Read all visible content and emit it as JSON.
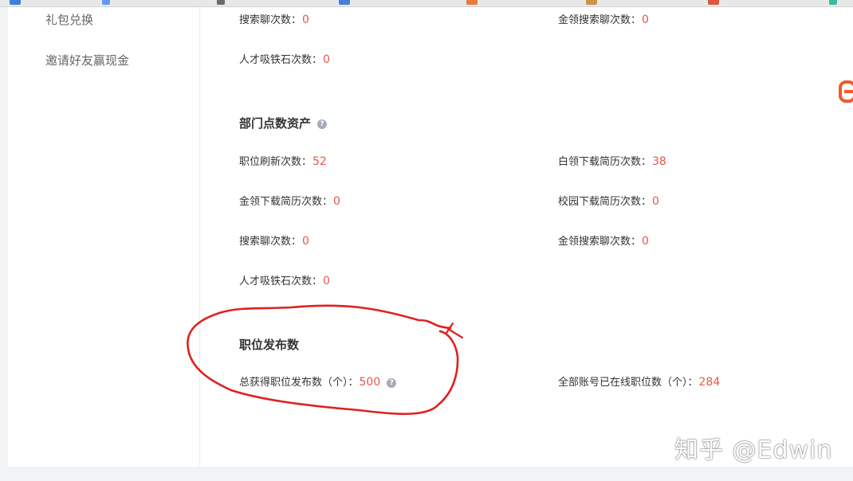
{
  "sidebar": {
    "items": [
      {
        "label": "礼包兑换"
      },
      {
        "label": "邀请好友赢现金"
      }
    ]
  },
  "top_rows": {
    "row1": [
      {
        "label": "搜索聊次数：",
        "value": "0"
      },
      {
        "label": "金领搜索聊次数：",
        "value": "0"
      }
    ],
    "row2": [
      {
        "label": "人才吸铁石次数：",
        "value": "0"
      }
    ]
  },
  "dept_section": {
    "title": "部门点数资产",
    "help_icon": "question-icon",
    "stats": [
      {
        "label": "职位刷新次数：",
        "value": "52"
      },
      {
        "label": "白领下载简历次数：",
        "value": "38"
      },
      {
        "label": "金领下载简历次数：",
        "value": "0"
      },
      {
        "label": "校园下载简历次数：",
        "value": "0"
      },
      {
        "label": "搜索聊次数：",
        "value": "0"
      },
      {
        "label": "金领搜索聊次数：",
        "value": "0"
      },
      {
        "label": "人才吸铁石次数：",
        "value": "0"
      }
    ]
  },
  "post_section": {
    "title": "职位发布数",
    "total": {
      "label": "总获得职位发布数（个）：",
      "value": "500"
    },
    "online": {
      "label": "全部账号已在线职位数（个）：",
      "value": "284"
    },
    "help_icon": "question-icon"
  },
  "colors": {
    "value": "#e8574c",
    "annotation": "#e02020",
    "corner_icon": "#ef5a2a"
  },
  "watermark": {
    "text": "知乎 @Edwin"
  }
}
